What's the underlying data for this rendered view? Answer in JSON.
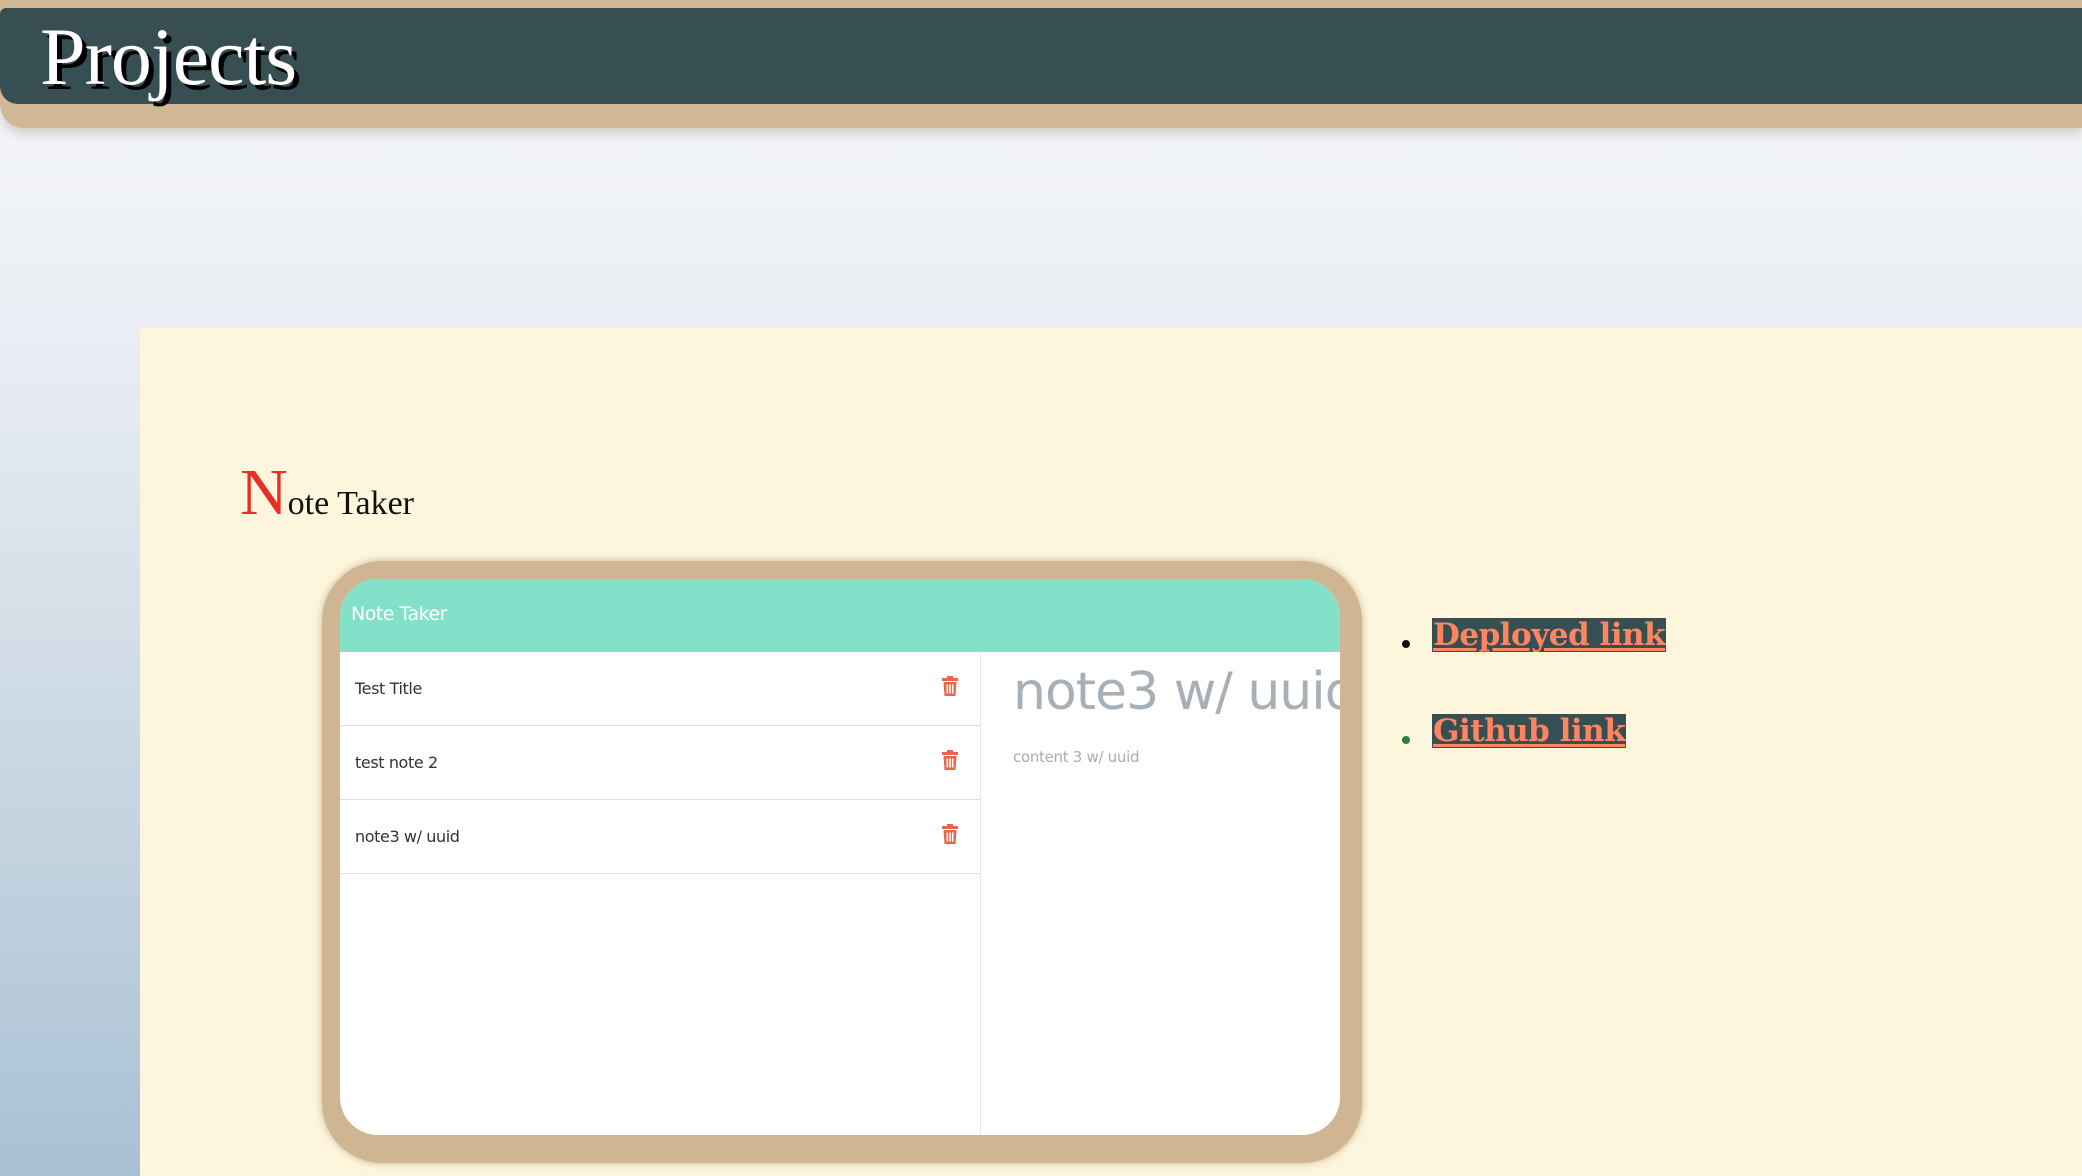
{
  "header": {
    "title": "Projects"
  },
  "project": {
    "title_initial": "N",
    "title_rest": "ote Taker",
    "screenshot": {
      "app_title": "Note Taker",
      "notes": [
        {
          "title": "Test Title"
        },
        {
          "title": "test note 2"
        },
        {
          "title": "note3 w/ uuid"
        }
      ],
      "active_note": {
        "title": "note3 w/ uuid",
        "text": "content 3 w/ uuid"
      },
      "icon_color": "#e8654a",
      "navbar_color": "#83e1ca"
    },
    "links": [
      {
        "label": "Deployed link"
      },
      {
        "label": "Github link"
      }
    ]
  },
  "colors": {
    "header_bg": "#374f53",
    "header_border": "#d1b895",
    "panel_bg": "#fdf6dd",
    "link_text": "#ff8560",
    "drop_cap": "#e5302a"
  }
}
